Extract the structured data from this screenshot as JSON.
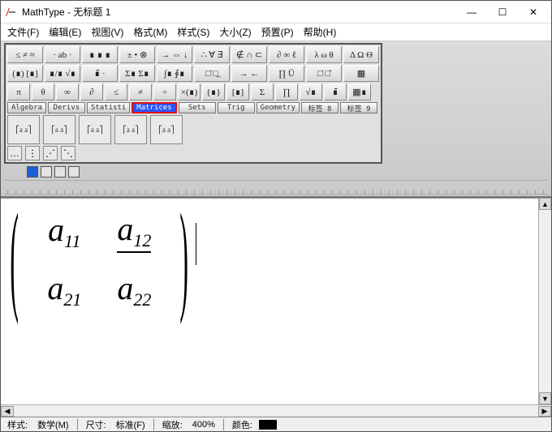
{
  "title": "MathType - 无标题 1",
  "menu": [
    "文件(F)",
    "编辑(E)",
    "视图(V)",
    "格式(M)",
    "样式(S)",
    "大小(Z)",
    "预置(P)",
    "帮助(H)"
  ],
  "toolbar_rows": [
    [
      "≤ ≠ ≈",
      "· ab ·",
      "∎ ∎ ∎",
      "± • ⊗",
      "→ ⇔ ↓",
      "∴ ∀ ∃",
      "∉ ∩ ⊂",
      "∂ ∞ ℓ",
      "λ ω θ",
      "Δ Ω Θ"
    ],
    [
      "(∎) [∎]",
      "∎/∎ √∎",
      "∎̄ ·",
      "Σ∎ Σ∎",
      "∫∎ ∮∎",
      "□̄ □̲",
      "→  ←",
      "∏ Ū",
      "□̇ □̂",
      "▦"
    ],
    [
      "π",
      "θ",
      "∞",
      "∂",
      "≤",
      "≠",
      "÷",
      "×(∎)",
      "{∎}",
      "[∎]",
      "Σ",
      "∏",
      "√∎",
      "∎̄",
      "▦∎"
    ]
  ],
  "tabs": [
    {
      "label": "Algebra",
      "active": false
    },
    {
      "label": "Derivs",
      "active": false
    },
    {
      "label": "Statisti",
      "active": false
    },
    {
      "label": "Matrices",
      "active": true
    },
    {
      "label": "Sets",
      "active": false
    },
    {
      "label": "Trig",
      "active": false
    },
    {
      "label": "Geometry",
      "active": false
    },
    {
      "label": "标签 8",
      "active": false
    },
    {
      "label": "标签 9",
      "active": false
    }
  ],
  "palettes": [
    "(a₁₁ a₁₂ / a₂₁ a₂₂)",
    "[a₁₁ … / a₂₁ …]",
    "|a₁₁ … / … aₙₙ|",
    "(1 0 / 0 1)",
    "[a 0 / 0 a] green"
  ],
  "palettes2": [
    "…",
    "⋮",
    "⋰",
    "⋱"
  ],
  "status": {
    "style_label": "样式:",
    "style_value": "数学(M)",
    "size_label": "尺寸:",
    "size_value": "标准(F)",
    "zoom_label": "缩放:",
    "zoom_value": "400%",
    "color_label": "颜色:",
    "color_value": "#000000"
  },
  "matrix": {
    "r1c1": "a",
    "r1c1_sub": "11",
    "r1c2": "a",
    "r1c2_sub": "12",
    "r2c1": "a",
    "r2c1_sub": "21",
    "r2c2": "a",
    "r2c2_sub": "22"
  }
}
